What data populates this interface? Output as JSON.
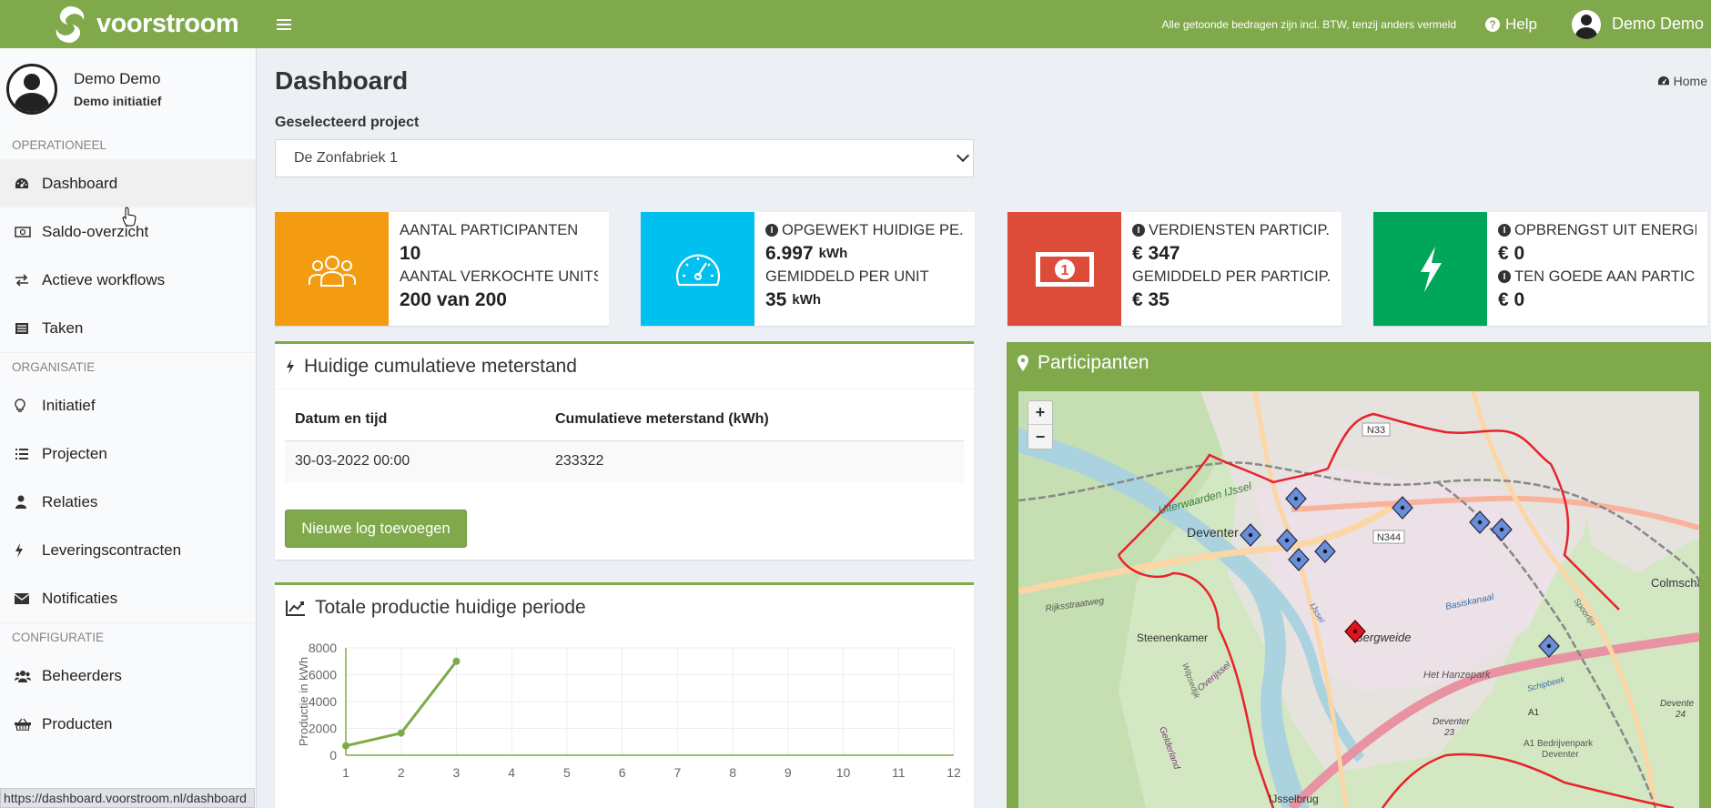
{
  "header": {
    "brand": "voorstroom",
    "vat_note": "Alle getoonde bedragen zijn incl. BTW, tenzij anders vermeld",
    "help": "Help",
    "user": "Demo Demo"
  },
  "sidebar": {
    "user_name": "Demo Demo",
    "user_role": "Demo initiatief",
    "sections": {
      "operationeel": "OPERATIONEEL",
      "organisatie": "ORGANISATIE",
      "configuratie": "CONFIGURATIE"
    },
    "items": {
      "dashboard": "Dashboard",
      "saldo": "Saldo-overzicht",
      "workflows": "Actieve workflows",
      "taken": "Taken",
      "initiatief": "Initiatief",
      "projecten": "Projecten",
      "relaties": "Relaties",
      "leveringscontracten": "Leveringscontracten",
      "notificaties": "Notificaties",
      "beheerders": "Beheerders",
      "producten": "Producten"
    }
  },
  "status_url": "https://dashboard.voorstroom.nl/dashboard",
  "page": {
    "title": "Dashboard",
    "breadcrumb": "Home",
    "project_label": "Geselecteerd project",
    "project_selected": "De Zonfabriek 1"
  },
  "info_boxes": [
    {
      "label1": "AANTAL PARTICIPANTEN",
      "value1": "10",
      "label2": "AANTAL VERKOCHTE UNITS",
      "value2": "200 van 200",
      "color": "#f39c12"
    },
    {
      "label1": "OPGEWEKT HUIDIGE PE...",
      "value1": "6.997",
      "unit1": "kWh",
      "label2": "GEMIDDELD PER UNIT",
      "value2": "35",
      "unit2": "kWh",
      "color": "#00c0ef"
    },
    {
      "label1": "VERDIENSTEN PARTICIP...",
      "value1": "€ 347",
      "label2": "GEMIDDELD PER PARTICIP...",
      "value2": "€ 35",
      "color": "#dd4b39"
    },
    {
      "label1": "OPBRENGST UIT ENERGIE",
      "value1": "€ 0",
      "label2": "TEN GOEDE AAN PARTIC...",
      "value2": "€ 0",
      "color": "#00a65a"
    }
  ],
  "meter": {
    "title": "Huidige cumulatieve meterstand",
    "col_date": "Datum en tijd",
    "col_value": "Cumulatieve meterstand (kWh)",
    "row_date": "30-03-2022 00:00",
    "row_value": "233322",
    "button": "Nieuwe log toevoegen"
  },
  "production": {
    "title": "Totale productie huidige periode"
  },
  "chart_data": {
    "type": "line",
    "ylabel": "Productie in kWh",
    "x": [
      1,
      2,
      3,
      4,
      5,
      6,
      7,
      8,
      9,
      10,
      11,
      12
    ],
    "series": [
      {
        "values": [
          700,
          1650,
          7000,
          null,
          null,
          null,
          null,
          null,
          null,
          null,
          null,
          null
        ]
      }
    ],
    "ylim": [
      0,
      8000
    ],
    "yticks": [
      0,
      2000,
      4000,
      6000,
      8000
    ],
    "grid": true,
    "color": "#7fa94b"
  },
  "map": {
    "title": "Participanten",
    "zoom_in": "+",
    "zoom_out": "−",
    "labels": {
      "deventer": "Deventer",
      "bergweide": "Bergweide",
      "steenenkamer": "Steenenkamer",
      "colmschate": "Colmschat",
      "hanzepark": "Het Hanzepark",
      "ijsselbrug": "IJsselbrug",
      "bedrijvenpark": "A1 Bedrijvenpark",
      "bedrijvenpark2": "Deventer",
      "uiterwaarden": "Uiterwaarden IJssel",
      "rijksstraatweg": "Rijksstraatweg",
      "basiskanaal": "Basiskanaal",
      "overijssel": "Overijssel",
      "gelderland": "Gelderland",
      "n344": "N344",
      "n33": "N33",
      "a1": "A1",
      "deventer23": "Deventer",
      "deventer23b": "23",
      "deventer24": "Devente",
      "deventer24b": "24",
      "wilpse": "Wilpsedijk",
      "schipbeek": "Schipbeek",
      "ijssel": "IJssel",
      "spoor": "Spoorlijn"
    }
  }
}
